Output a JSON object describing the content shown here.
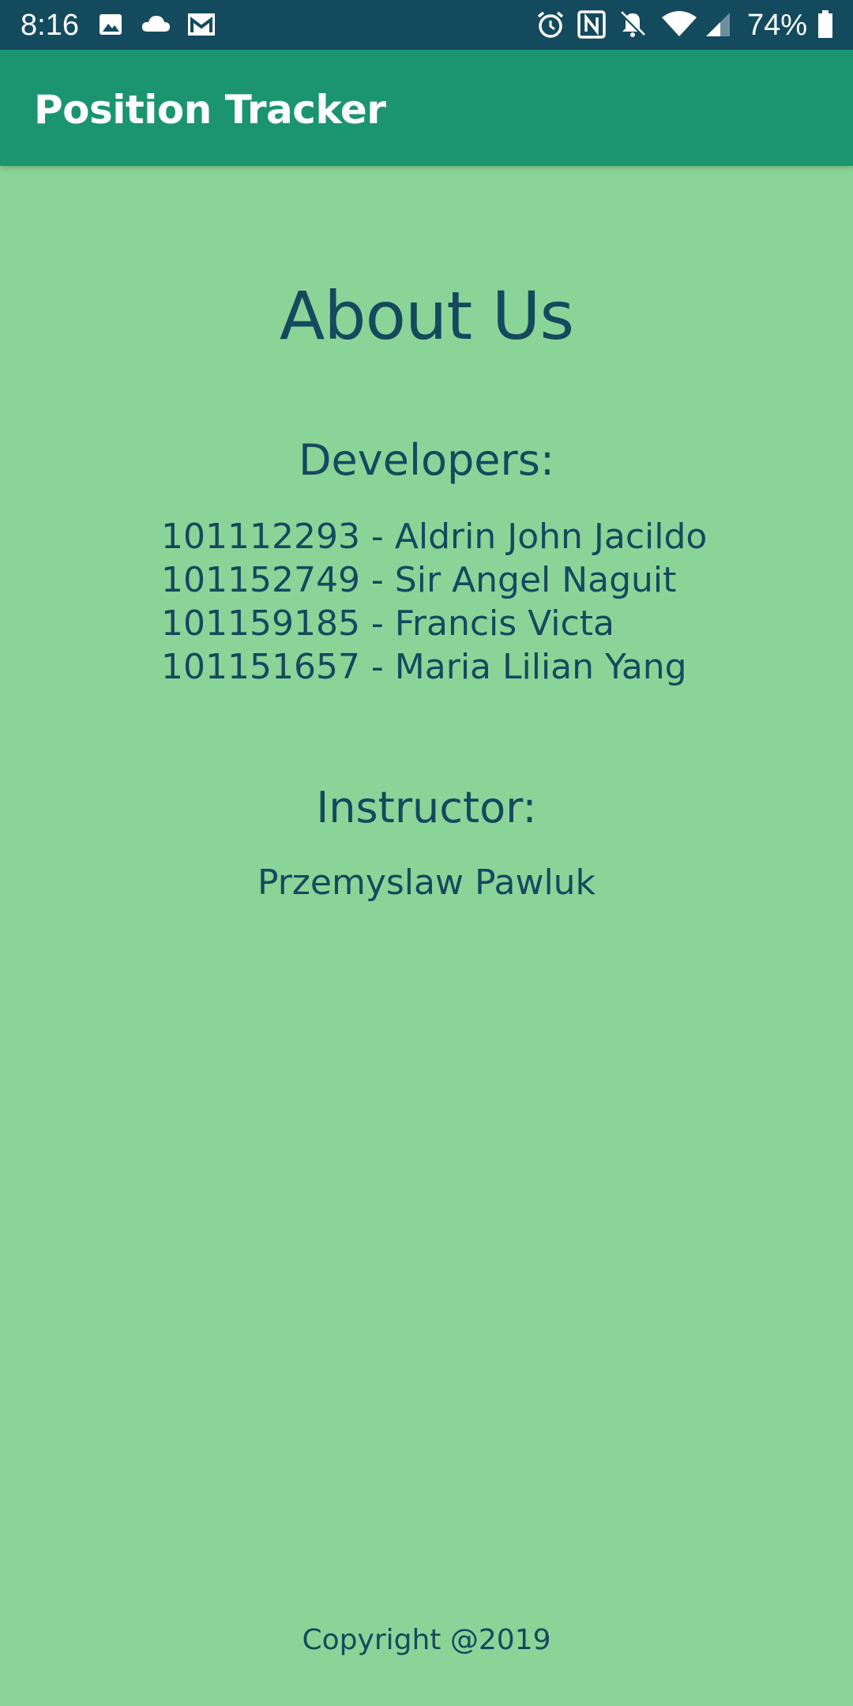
{
  "status_bar": {
    "time": "8:16",
    "battery": "74%",
    "left_icons": [
      "image-icon",
      "cloud-icon",
      "gmail-icon"
    ],
    "right_icons": [
      "alarm-icon",
      "nfc-icon",
      "bell-off-icon",
      "wifi-icon",
      "signal-icon",
      "battery-icon"
    ]
  },
  "app_bar": {
    "title": "Position Tracker"
  },
  "about": {
    "title": "About Us",
    "developers_heading": "Developers:",
    "developers": [
      "101112293 - Aldrin John Jacildo",
      "101152749 - Sir Angel Naguit",
      "101159185 - Francis Victa",
      "101151657 - Maria Lilian Yang"
    ],
    "instructor_heading": "Instructor:",
    "instructor_name": "Przemyslaw Pawluk"
  },
  "footer": {
    "copyright": "Copyright @2019"
  },
  "colors": {
    "status_bar": "#134a5e",
    "app_bar": "#1b956f",
    "background": "#8bd498",
    "text": "#134a5e"
  }
}
